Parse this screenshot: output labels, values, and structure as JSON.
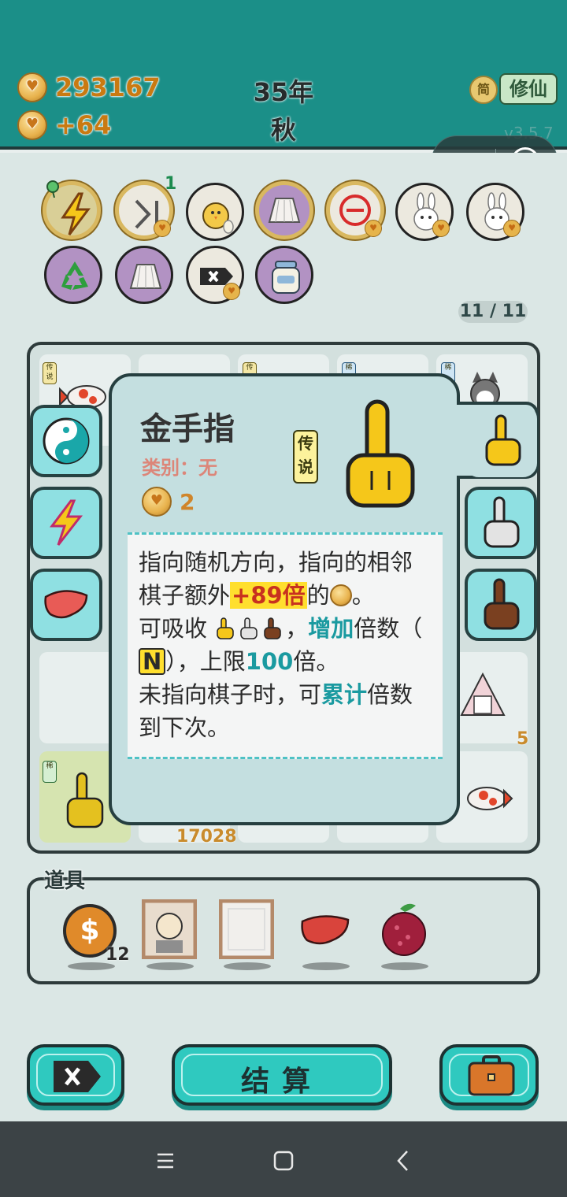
{
  "header": {
    "coins": "293167",
    "income": "+64",
    "year": "35年",
    "season": "秋",
    "simplified_btn": "简",
    "cultivate_btn": "修仙",
    "version": "v3.5.7"
  },
  "miniprogram_capsule": {
    "more_icon": "•••"
  },
  "toolbar": {
    "skip_count": "1",
    "tools": [
      "lightning-icon",
      "skip-icon",
      "chick-icon",
      "skirt-icon",
      "remove-icon",
      "rabbit-icon",
      "rabbit-icon",
      "recycle-icon",
      "skirt-icon",
      "delete-tag-icon",
      "jar-icon"
    ]
  },
  "pager": "11 / 11",
  "board": {
    "tags": [
      "传说",
      "传",
      "稀",
      "稀",
      "稀"
    ],
    "value_17028": "17028",
    "count_5": "5"
  },
  "card": {
    "title": "金手指",
    "category": "类别：无",
    "rarity": "传说",
    "cost": "2",
    "desc_1": "指向随机方向，指向的相邻棋子额外",
    "desc_bonus": "+89倍",
    "desc_2": "的",
    "desc_3": "。",
    "desc_4": "可吸收",
    "desc_5": "，",
    "desc_increase": "增加",
    "desc_6": "倍数（",
    "desc_n": "N",
    "desc_7": "），上限",
    "desc_limit": "100",
    "desc_8": "倍。",
    "desc_9": "未指向棋子时，可",
    "desc_accumulate": "累计",
    "desc_10": "倍数到下次。"
  },
  "items": {
    "label": "道具",
    "coin_count": "12",
    "dollar_symbol": "$"
  },
  "actions": {
    "settle": "结算"
  },
  "colors": {
    "topbar": "#1b8f88",
    "card_bg": "#c4dfe0",
    "button_teal": "#2fc9bf",
    "highlight_red": "#c8321f",
    "highlight_teal": "#1a9aa0"
  }
}
